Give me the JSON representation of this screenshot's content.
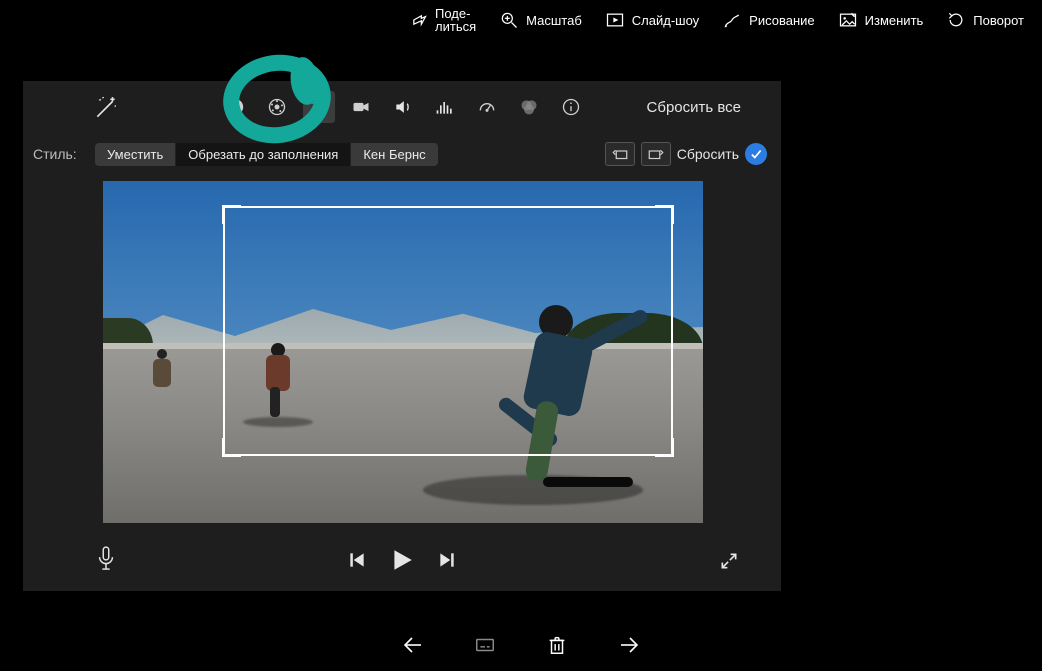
{
  "top_menu": {
    "share": "Поде-\nлиться",
    "zoom": "Масштаб",
    "slideshow": "Слайд-шоу",
    "draw": "Рисование",
    "edit": "Изменить",
    "rotate": "Поворот"
  },
  "toolbar": {
    "reset_all": "Сбросить все"
  },
  "style_row": {
    "label": "Стиль:",
    "fit": "Уместить",
    "crop_fill": "Обрезать до заполнения",
    "ken_burns": "Кен Бернс",
    "reset": "Сбросить"
  }
}
